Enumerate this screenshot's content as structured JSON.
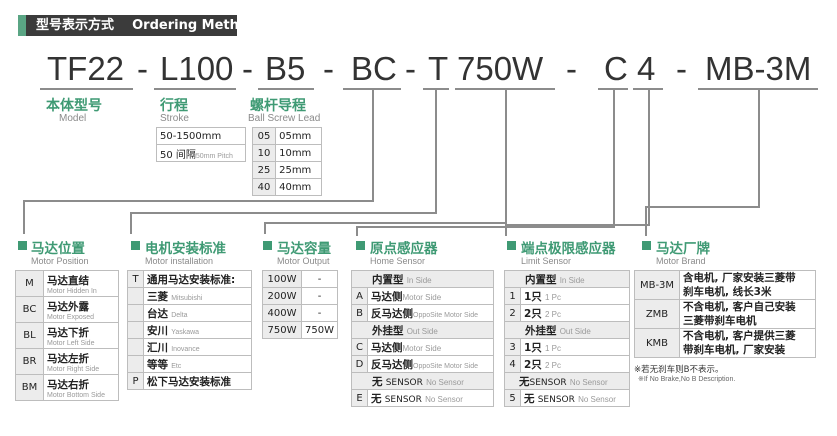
{
  "header": {
    "title_cn": "型号表示方式",
    "title_en": "Ordering Method"
  },
  "code": {
    "tf22": "TF22",
    "d1": "-",
    "l100": "L100",
    "d2": "-",
    "b5": "B5",
    "d3": "-",
    "bc": "BC",
    "d4": "-",
    "t": "T",
    "w750": "750W",
    "d5": "-",
    "c": "C",
    "n4": "4",
    "d6": "-",
    "mb3m": "MB-3M"
  },
  "model": {
    "cn": "本体型号",
    "en": "Model"
  },
  "stroke": {
    "cn": "行程",
    "en": "Stroke",
    "rows": [
      "50-1500mm",
      "50 间隔"
    ],
    "pitch_en": "50mm Pitch"
  },
  "lead": {
    "cn": "螺杆导程",
    "en": "Ball Screw Lead",
    "rows": [
      [
        "05",
        "05mm"
      ],
      [
        "10",
        "10mm"
      ],
      [
        "25",
        "25mm"
      ],
      [
        "40",
        "40mm"
      ]
    ]
  },
  "position": {
    "cn": "马达位置",
    "en": "Motor Position",
    "rows": [
      {
        "code": "M",
        "cn": "马达直结",
        "en": "Motor Hidden In"
      },
      {
        "code": "BC",
        "cn": "马达外露",
        "en": "Motor Exposed"
      },
      {
        "code": "BL",
        "cn": "马达下折",
        "en": "Motor Left Side"
      },
      {
        "code": "BR",
        "cn": "马达左折",
        "en": "Motor Right Side"
      },
      {
        "code": "BM",
        "cn": "马达右折",
        "en": "Motor Bottom Side"
      }
    ]
  },
  "install": {
    "cn": "电机安装标准",
    "en": "Motor installation",
    "t_code": "T",
    "t_label": "通用马达安装标准:",
    "brands": [
      {
        "cn": "三菱",
        "en": "Mitsubishi"
      },
      {
        "cn": "台达",
        "en": "Delta"
      },
      {
        "cn": "安川",
        "en": "Yaskawa"
      },
      {
        "cn": "汇川",
        "en": "Inovance"
      },
      {
        "cn": "等等",
        "en": "Etc"
      }
    ],
    "p_code": "P",
    "p_label": "松下马达安装标准"
  },
  "output": {
    "cn": "马达容量",
    "en": "Motor Output",
    "rows": [
      [
        "100W",
        "-"
      ],
      [
        "200W",
        "-"
      ],
      [
        "400W",
        "-"
      ],
      [
        "750W",
        "750W"
      ]
    ]
  },
  "home": {
    "cn": "原点感应器",
    "en": "Home Sensor",
    "inside_cn": "内置型",
    "inside_en": "In Side",
    "outside_cn": "外挂型",
    "outside_en": "Out Side",
    "rows_in": [
      {
        "code": "A",
        "cn": "马达侧",
        "en": "Motor Side"
      },
      {
        "code": "B",
        "cn": "反马达侧",
        "en": "OppoSite Motor Side"
      }
    ],
    "rows_out": [
      {
        "code": "C",
        "cn": "马达侧",
        "en": "Motor Side"
      },
      {
        "code": "D",
        "cn": "反马达侧",
        "en": "OppoSite Motor Side"
      }
    ],
    "none": {
      "cn": "无",
      "sensor": "SENSOR",
      "en": "No Sensor"
    },
    "e_row": {
      "code": "E",
      "cn": "无",
      "sensor": "SENSOR",
      "en": "No Sensor"
    }
  },
  "limit": {
    "cn": "端点极限感应器",
    "en": "Limit Sensor",
    "inside_cn": "内置型",
    "inside_en": "In Side",
    "outside_cn": "外挂型",
    "outside_en": "Out Side",
    "rows_in": [
      {
        "code": "1",
        "cn": "1只",
        "en": "1 Pc"
      },
      {
        "code": "2",
        "cn": "2只",
        "en": "2 Pc"
      }
    ],
    "rows_out": [
      {
        "code": "3",
        "cn": "1只",
        "en": "1 Pc"
      },
      {
        "code": "4",
        "cn": "2只",
        "en": "2 Pc"
      }
    ],
    "none": {
      "cn": "无",
      "sensor": "SENSOR",
      "en": "No Sensor"
    },
    "five_row": {
      "code": "5",
      "cn": "无",
      "sensor": "SENSOR",
      "en": "No Sensor"
    }
  },
  "brand": {
    "cn": "马达厂牌",
    "en": "Motor Brand",
    "rows": [
      {
        "code": "MB-3M",
        "l1": "含电机, 厂家安装三菱带",
        "l2": "刹车电机, 线长3米"
      },
      {
        "code": "ZMB",
        "l1": "不含电机, 客户自己安装",
        "l2": "三菱带刹车电机"
      },
      {
        "code": "KMB",
        "l1": "不含电机, 客户提供三菱",
        "l2": "带刹车电机, 厂家安装"
      }
    ],
    "note_cn": "※若无刹车则B不表示。",
    "note_en": "※If No Brake,No B Description."
  },
  "colors": {
    "accent": "#3f9a74",
    "header_bg": "#3b3b3b",
    "line": "#8c8c8c"
  }
}
